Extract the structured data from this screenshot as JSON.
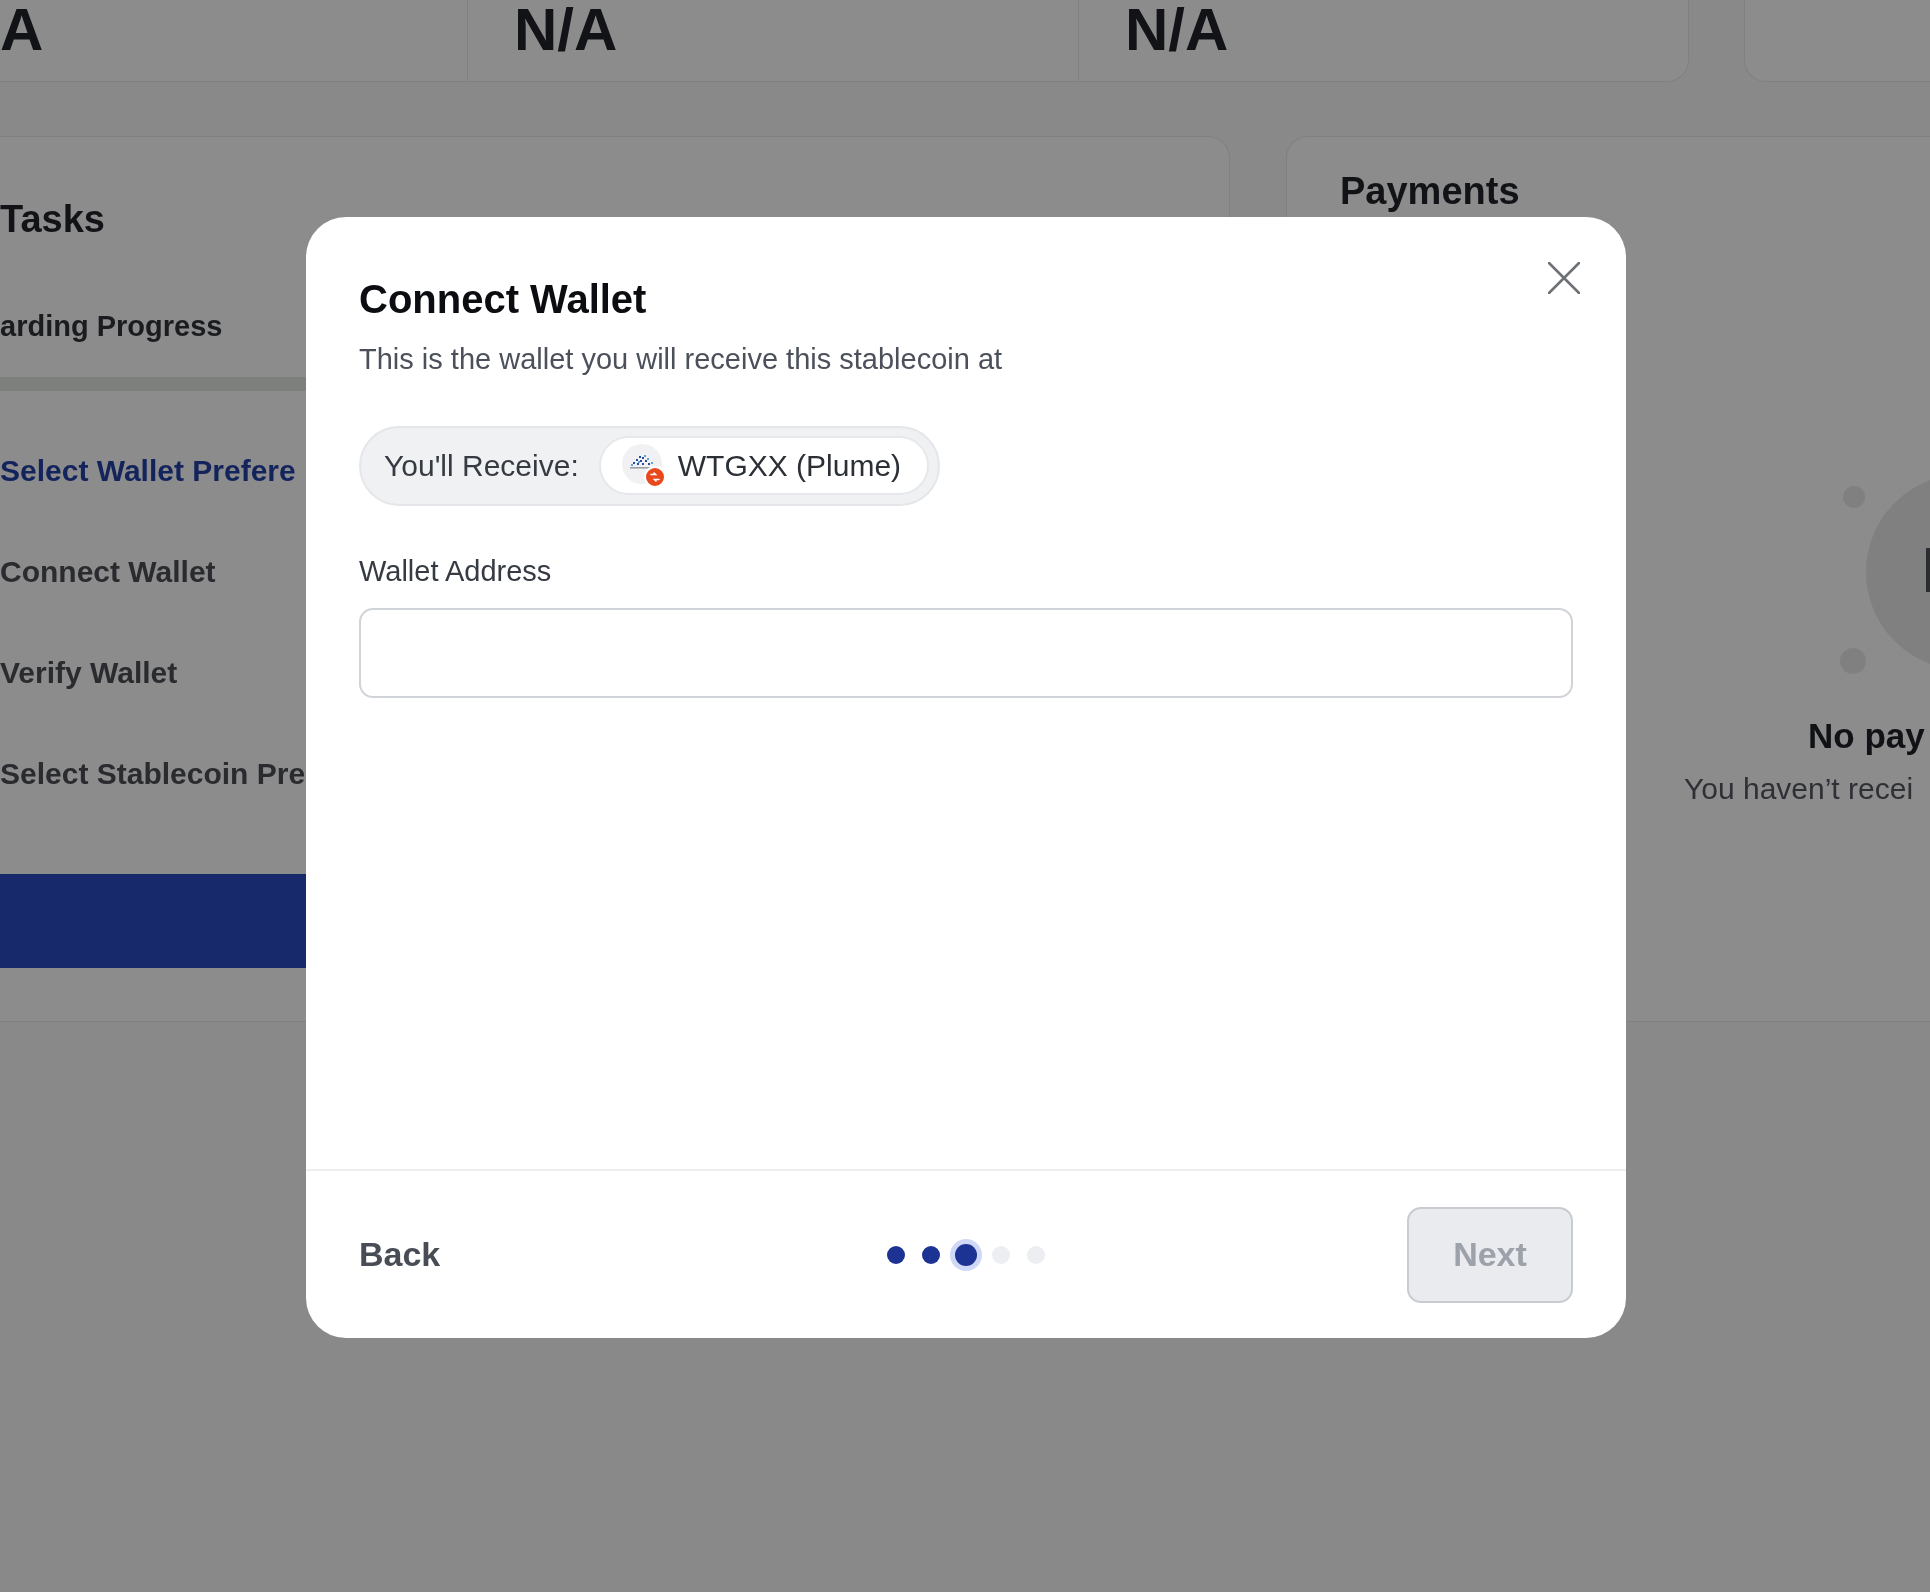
{
  "background": {
    "stats": [
      {
        "value": "A"
      },
      {
        "value": "N/A"
      },
      {
        "value": "N/A"
      }
    ],
    "tasks_card": {
      "title": "Tasks",
      "subtitle": "arding Progress",
      "steps": [
        {
          "label": "Select Wallet Prefere",
          "selected": true
        },
        {
          "label": "Connect Wallet",
          "selected": false
        },
        {
          "label": "Verify Wallet",
          "selected": false
        },
        {
          "label": "Select Stablecoin Pre",
          "selected": false
        }
      ]
    },
    "payments_card": {
      "title": "Payments",
      "empty_title": "No pay",
      "empty_text": "You haven’t recei"
    }
  },
  "modal": {
    "title": "Connect Wallet",
    "subtitle": "This is the wallet you will receive this stablecoin at",
    "receive_label": "You'll Receive:",
    "token": "WTGXX (Plume)",
    "field_label": "Wallet Address",
    "back_button": "Back",
    "steps": [
      {
        "selected": false
      },
      {
        "selected": false
      },
      {
        "selected": true
      },
      {
        "selected": false
      },
      {
        "selected": false
      }
    ],
    "next_button": {
      "label": "Next",
      "disabled": true
    }
  }
}
